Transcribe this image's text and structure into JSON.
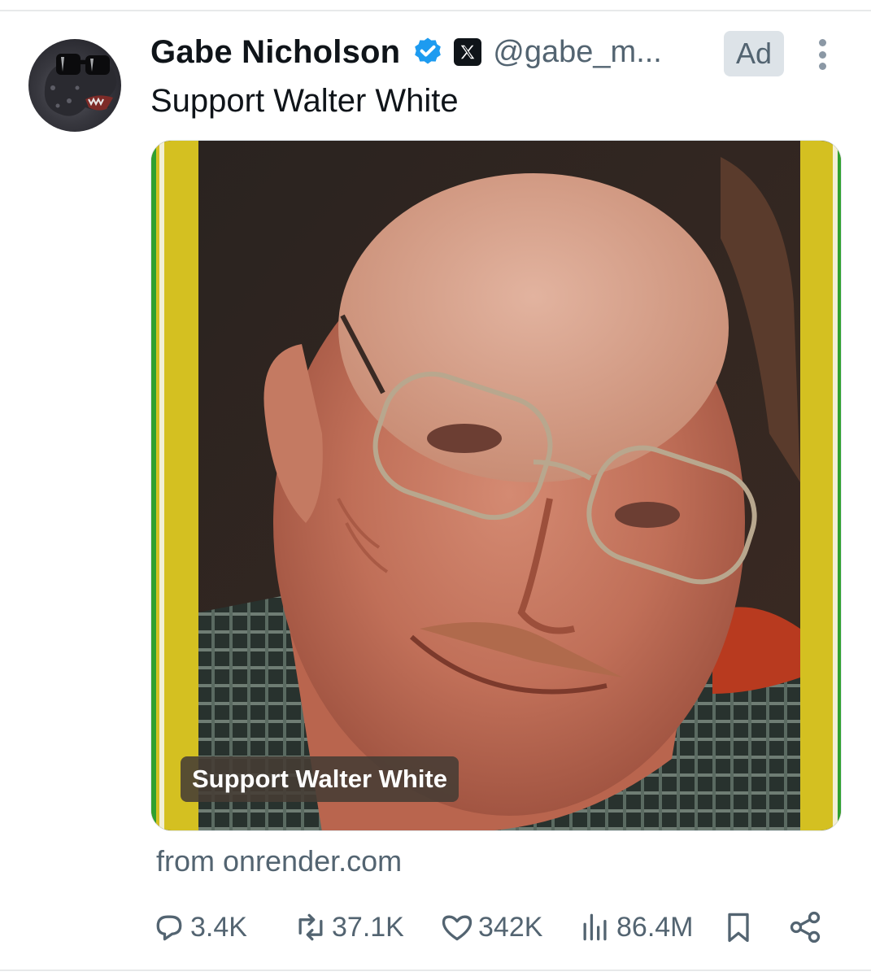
{
  "author": {
    "name": "Gabe Nicholson",
    "handle": "@gabe_m...",
    "verified": true
  },
  "ad_label": "Ad",
  "tweet": {
    "text": "Support Walter White",
    "media_caption": "Support Walter White",
    "source": "from onrender.com"
  },
  "stats": {
    "replies": "3.4K",
    "reposts": "37.1K",
    "likes": "342K",
    "views": "86.4M"
  },
  "colors": {
    "verified": "#1d9bf0",
    "muted_text": "#536471",
    "frame_yellow": "#d4c021",
    "frame_green": "#2fa02f"
  },
  "icons": [
    "verified-icon",
    "x-logo-icon",
    "more-icon",
    "reply-icon",
    "repost-icon",
    "like-icon",
    "views-icon",
    "bookmark-icon",
    "share-icon"
  ]
}
